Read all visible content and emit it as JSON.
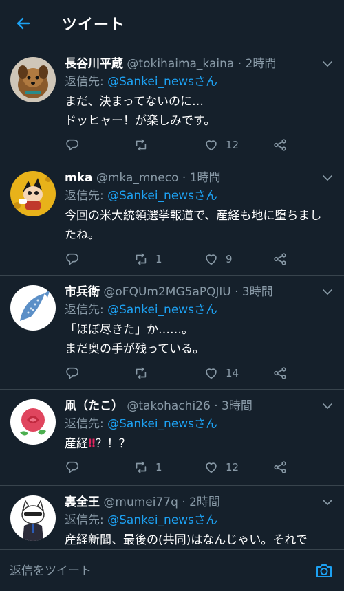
{
  "header": {
    "title": "ツイート"
  },
  "tweets": [
    {
      "name": "長谷川平蔵",
      "handle": "@tokihaima_kaina",
      "time": "· 2時間",
      "reply_prefix": "返信先: ",
      "reply_mention": "@Sankei_newsさん",
      "body": "まだ、決まってないのに…\nドッヒャー！が楽しみです。",
      "reply_count": "",
      "retweet_count": "",
      "like_count": "12",
      "avatar": "dog-avatar"
    },
    {
      "name": "mka",
      "handle": "@mka_mneco",
      "time": "· 1時間",
      "reply_prefix": "返信先: ",
      "reply_mention": "@Sankei_newsさん",
      "body": "今回の米大統領選挙報道で、産経も地に堕ちましたね。",
      "reply_count": "",
      "retweet_count": "1",
      "like_count": "9",
      "avatar": "astroboy-avatar"
    },
    {
      "name": "市兵衛",
      "handle": "@oFQUm2MG5aPQJlU",
      "time": "· 3時間",
      "reply_prefix": "返信先: ",
      "reply_mention": "@Sankei_newsさん",
      "body": "「ほぼ尽きた」か……。\nまだ奥の手が残っている。",
      "reply_count": "",
      "retweet_count": "",
      "like_count": "14",
      "avatar": "whale-shark-avatar"
    },
    {
      "name": "凧（たこ）",
      "handle": "@takohachi26",
      "time": "· 3時間",
      "reply_prefix": "返信先: ",
      "reply_mention": "@Sankei_newsさん",
      "body_prefix": "産経",
      "body_bang": "‼",
      "body_suffix": "？！？",
      "reply_count": "",
      "retweet_count": "1",
      "like_count": "12",
      "avatar": "rose-avatar"
    },
    {
      "name": "裏全王",
      "handle": "@mumei77q",
      "time": "· 2時間",
      "reply_prefix": "返信先: ",
      "reply_mention": "@Sankei_newsさん",
      "body": "産経新聞、最後の(共同)はなんじゃい。それで",
      "avatar": "cat-avatar"
    }
  ],
  "compose": {
    "placeholder": "返信をツイート"
  },
  "colors": {
    "background": "#15202b",
    "accent": "#1da1f2",
    "muted": "#8899a6",
    "divider": "#38444d"
  },
  "icons": [
    "back-arrow-icon",
    "chevron-down-icon",
    "reply-icon",
    "retweet-icon",
    "like-icon",
    "share-icon",
    "camera-icon"
  ]
}
